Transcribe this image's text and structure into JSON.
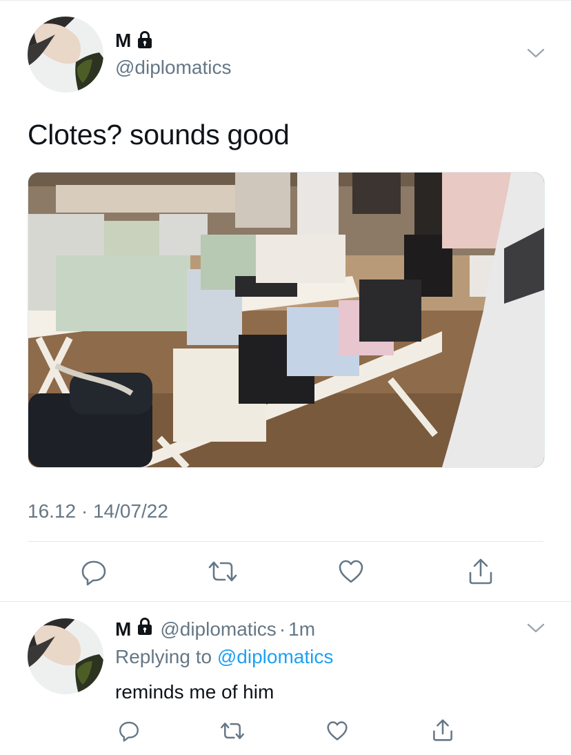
{
  "tweet": {
    "author": {
      "name": "M",
      "handle": "@diplomatics",
      "protected_icon": "lock-icon",
      "avatar": "profile-photo"
    },
    "text": "Clotes? sounds good",
    "media": {
      "type": "photo",
      "subject": "clothing store with folded sweatshirts on white tables"
    },
    "timestamp": "16.12 · 14/07/22",
    "actions": [
      {
        "name": "reply",
        "icon": "reply-icon"
      },
      {
        "name": "retweet",
        "icon": "retweet-icon"
      },
      {
        "name": "like",
        "icon": "heart-icon"
      },
      {
        "name": "share",
        "icon": "share-icon"
      }
    ],
    "menu_icon": "chevron-down-icon"
  },
  "reply": {
    "author": {
      "name": "M",
      "handle": "@diplomatics",
      "protected_icon": "lock-icon"
    },
    "separator": "·",
    "time": "1m",
    "replying_label": "Replying to",
    "replying_to": "@diplomatics",
    "text": "reminds me of him",
    "menu_icon": "chevron-down-icon"
  },
  "colors": {
    "text": "#0f1419",
    "secondary": "#657786",
    "link": "#1da1f2",
    "divider": "#e1e8ed"
  }
}
